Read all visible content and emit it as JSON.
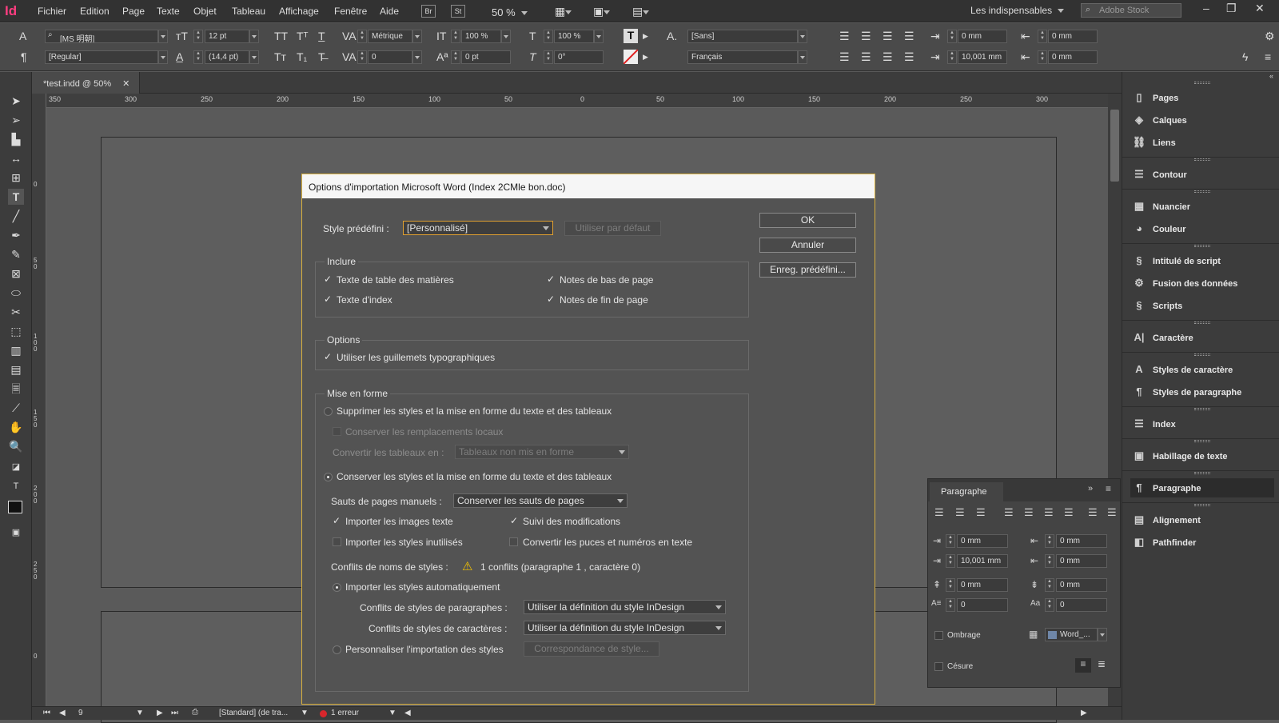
{
  "app": {
    "logo": "Id",
    "menu": [
      "Fichier",
      "Edition",
      "Page",
      "Texte",
      "Objet",
      "Tableau",
      "Affichage",
      "Fenêtre",
      "Aide"
    ],
    "br_label": "Br",
    "st_label": "St",
    "zoom": "50 %",
    "workspace": "Les indispensables",
    "stock_placeholder": "Adobe Stock"
  },
  "control": {
    "font": "[MS 明朝]",
    "style": "[Regular]",
    "size": "12 pt",
    "leading": "(14,4 pt)",
    "kerning": "Métrique",
    "tracking": "0",
    "vscale": "100 %",
    "hscale": "100 %",
    "baseline": "0 pt",
    "skew": "0°",
    "charstyle": "[Sans]",
    "language": "Français",
    "indent_left": "0 mm",
    "indent_right": "0 mm",
    "first_line": "10,001 mm",
    "last_line": "0 mm"
  },
  "tab": {
    "label": "*test.indd @ 50%"
  },
  "ruler": [
    "350",
    "300",
    "250",
    "200",
    "150",
    "100",
    "50",
    "0",
    "50",
    "100",
    "150",
    "200",
    "250",
    "300"
  ],
  "vruler": [
    "0",
    "5 0",
    "1 0 0",
    "1 5 0",
    "2 0 0",
    "2 5 0",
    "0"
  ],
  "status": {
    "page": "9",
    "style": "[Standard] (de tra...",
    "errors": "1 erreur"
  },
  "panels": [
    "Pages",
    "Calques",
    "Liens",
    "Contour",
    "Nuancier",
    "Couleur",
    "Intitulé de script",
    "Fusion des données",
    "Scripts",
    "Caractère",
    "Styles de caractère",
    "Styles de paragraphe",
    "Index",
    "Habillage de texte",
    "Paragraphe",
    "Alignement",
    "Pathfinder"
  ],
  "para_panel": {
    "title": "Paragraphe",
    "v1": "0 mm",
    "v2": "0 mm",
    "v3": "10,001 mm",
    "v4": "0 mm",
    "v5": "0 mm",
    "v6": "0 mm",
    "v7": "0",
    "v8": "0",
    "shading": "Ombrage",
    "hyphen": "Césure",
    "swatch": "Word_..."
  },
  "dialog": {
    "title": "Options d'importation Microsoft Word (Index 2CMle bon.doc)",
    "preset_label": "Style prédéfini :",
    "preset_value": "[Personnalisé]",
    "default_btn": "Utiliser par défaut",
    "ok": "OK",
    "cancel": "Annuler",
    "save_preset": "Enreg. prédéfini...",
    "include": {
      "title": "Inclure",
      "toc": "Texte de table des matières",
      "index": "Texte d'index",
      "footnotes": "Notes de bas de page",
      "endnotes": "Notes de fin de page"
    },
    "options": {
      "title": "Options",
      "quotes": "Utiliser les guillemets typographiques"
    },
    "format": {
      "title": "Mise en forme",
      "remove": "Supprimer les styles et la mise en forme du texte et des tableaux",
      "keep_local": "Conserver les remplacements locaux",
      "convert_label": "Convertir les tableaux en :",
      "convert_value": "Tableaux non mis en forme",
      "preserve": "Conserver les styles et la mise en forme du texte et des tableaux",
      "breaks_label": "Sauts de pages manuels :",
      "breaks_value": "Conserver les sauts de pages",
      "inline_graphics": "Importer les images texte",
      "track_changes": "Suivi des modifications",
      "unused_styles": "Importer les styles inutilisés",
      "bullets": "Convertir les puces et numéros en texte",
      "conflicts_label": "Conflits de noms de styles :",
      "conflicts_value": "1 conflits (paragraphe 1 , caractère 0)",
      "auto_import": "Importer les styles automatiquement",
      "para_conflicts_label": "Conflits de styles de paragraphes :",
      "para_conflicts_value": "Utiliser la définition du style InDesign",
      "char_conflicts_label": "Conflits de styles de caractères :",
      "char_conflicts_value": "Utiliser la définition du style InDesign",
      "customize": "Personnaliser l'importation des styles",
      "mapping_btn": "Correspondance de style..."
    }
  }
}
